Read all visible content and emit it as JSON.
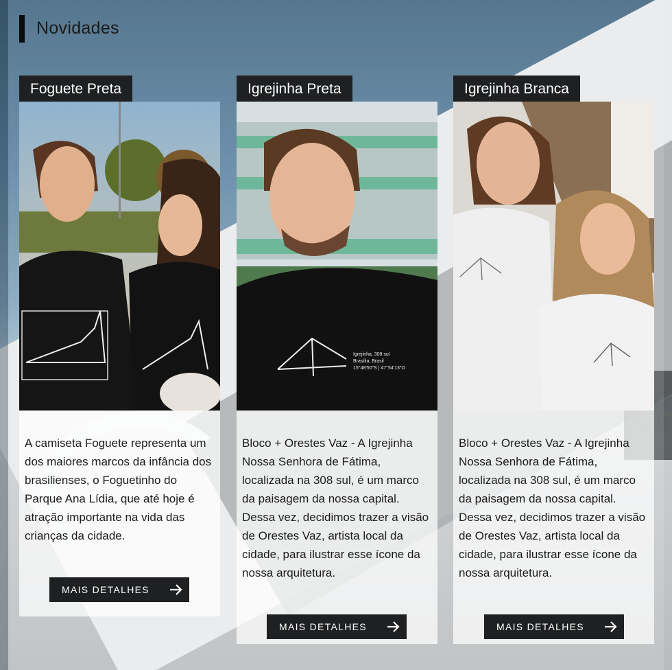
{
  "section": {
    "title": "Novidades"
  },
  "cards": [
    {
      "title": "Foguete Preta",
      "description": "A camiseta Foguete representa um dos maiores marcos da infância dos brasilienses, o Foguetinho do Parque Ana Lídia, que até hoje é atração importante na vida das crianças da cidade.",
      "button": "MAIS DETALHES"
    },
    {
      "title": "Igrejinha Preta",
      "description": "Bloco + Orestes Vaz - A Igrejinha Nossa Senhora de Fátima, localizada na 308 sul, é um marco da paisagem da nossa capital. Dessa vez, decidimos trazer a visão de Orestes Vaz, artista local da cidade, para ilustrar esse ícone da nossa arquitetura.",
      "button": "MAIS DETALHES",
      "shirt_print": "Igrejinha, 308 sul\nBrasília, Brasil\n15°48'50\"S | 47°54'13\"O"
    },
    {
      "title": "Igrejinha Branca",
      "description": "Bloco + Orestes Vaz - A Igrejinha Nossa Senhora de Fátima, localizada na 308 sul, é um marco da paisagem da nossa capital. Dessa vez, decidimos trazer a visão de Orestes Vaz, artista local da cidade, para ilustrar esse ícone da nossa arquitetura.",
      "button": "MAIS DETALHES"
    }
  ],
  "colors": {
    "dark": "#1f2022",
    "accent_bar": "#0b0b0b"
  },
  "icons": {
    "button_icon": "arrow-right-icon"
  }
}
